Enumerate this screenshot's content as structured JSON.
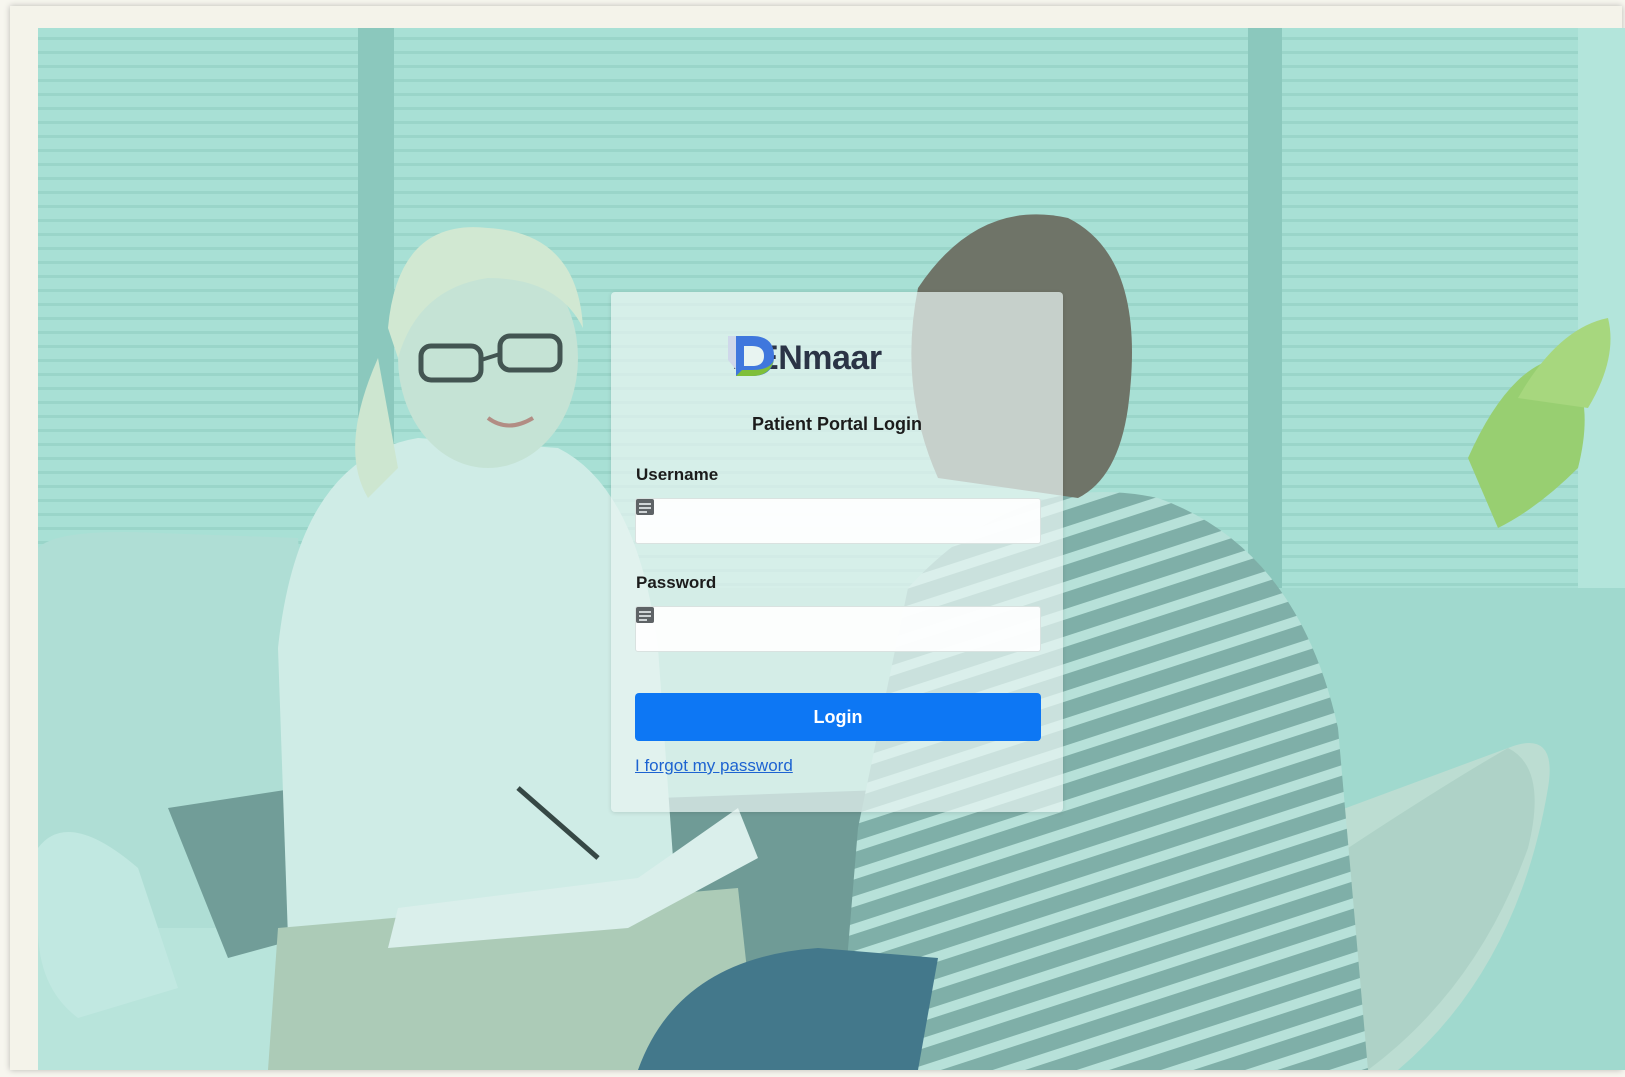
{
  "brand": {
    "name": "DENmaar",
    "colors": {
      "mark_blue": "#3f77dd",
      "mark_green": "#7fbf3a",
      "text": "#2b3446"
    }
  },
  "login": {
    "title": "Patient Portal Login",
    "username_label": "Username",
    "username_value": "",
    "username_icon": "contact-card-icon",
    "password_label": "Password",
    "password_value": "",
    "password_icon": "contact-card-icon",
    "submit_label": "Login",
    "forgot_link": "I forgot my password"
  },
  "colors": {
    "overlay_tint": "#9fd9cd",
    "button": "#0d77f4",
    "link": "#1d63d1"
  }
}
